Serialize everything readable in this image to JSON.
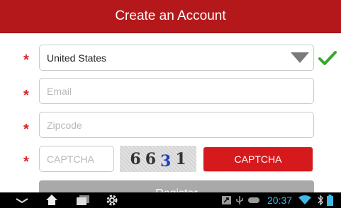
{
  "header": {
    "title": "Create an Account"
  },
  "form": {
    "required_mark": "*",
    "country": {
      "value": "United States"
    },
    "email": {
      "placeholder": "Email",
      "value": ""
    },
    "zipcode": {
      "placeholder": "Zipcode",
      "value": ""
    },
    "captcha": {
      "placeholder": "CAPTCHA",
      "value": "",
      "image_chars": [
        "6",
        "6",
        "3",
        "1"
      ],
      "image_colors": [
        "#333333",
        "#333333",
        "#1f3fb8",
        "#333333"
      ],
      "button_label": "CAPTCHA"
    },
    "register_label": "Register"
  },
  "status_bar": {
    "time": "20:37",
    "nav_icons": [
      "back-icon",
      "home-icon",
      "recent-apps-icon",
      "settings-icon"
    ],
    "status_icons": [
      "notification-icon",
      "usb-icon",
      "controller-icon",
      "wifi-icon",
      "battery-icon"
    ]
  },
  "colors": {
    "header": "#b4181a",
    "required": "#d8252a",
    "check": "#3aa62c",
    "captcha_button": "#d6191c",
    "register_button": "#a9a9a9",
    "time": "#3fb8e8"
  }
}
